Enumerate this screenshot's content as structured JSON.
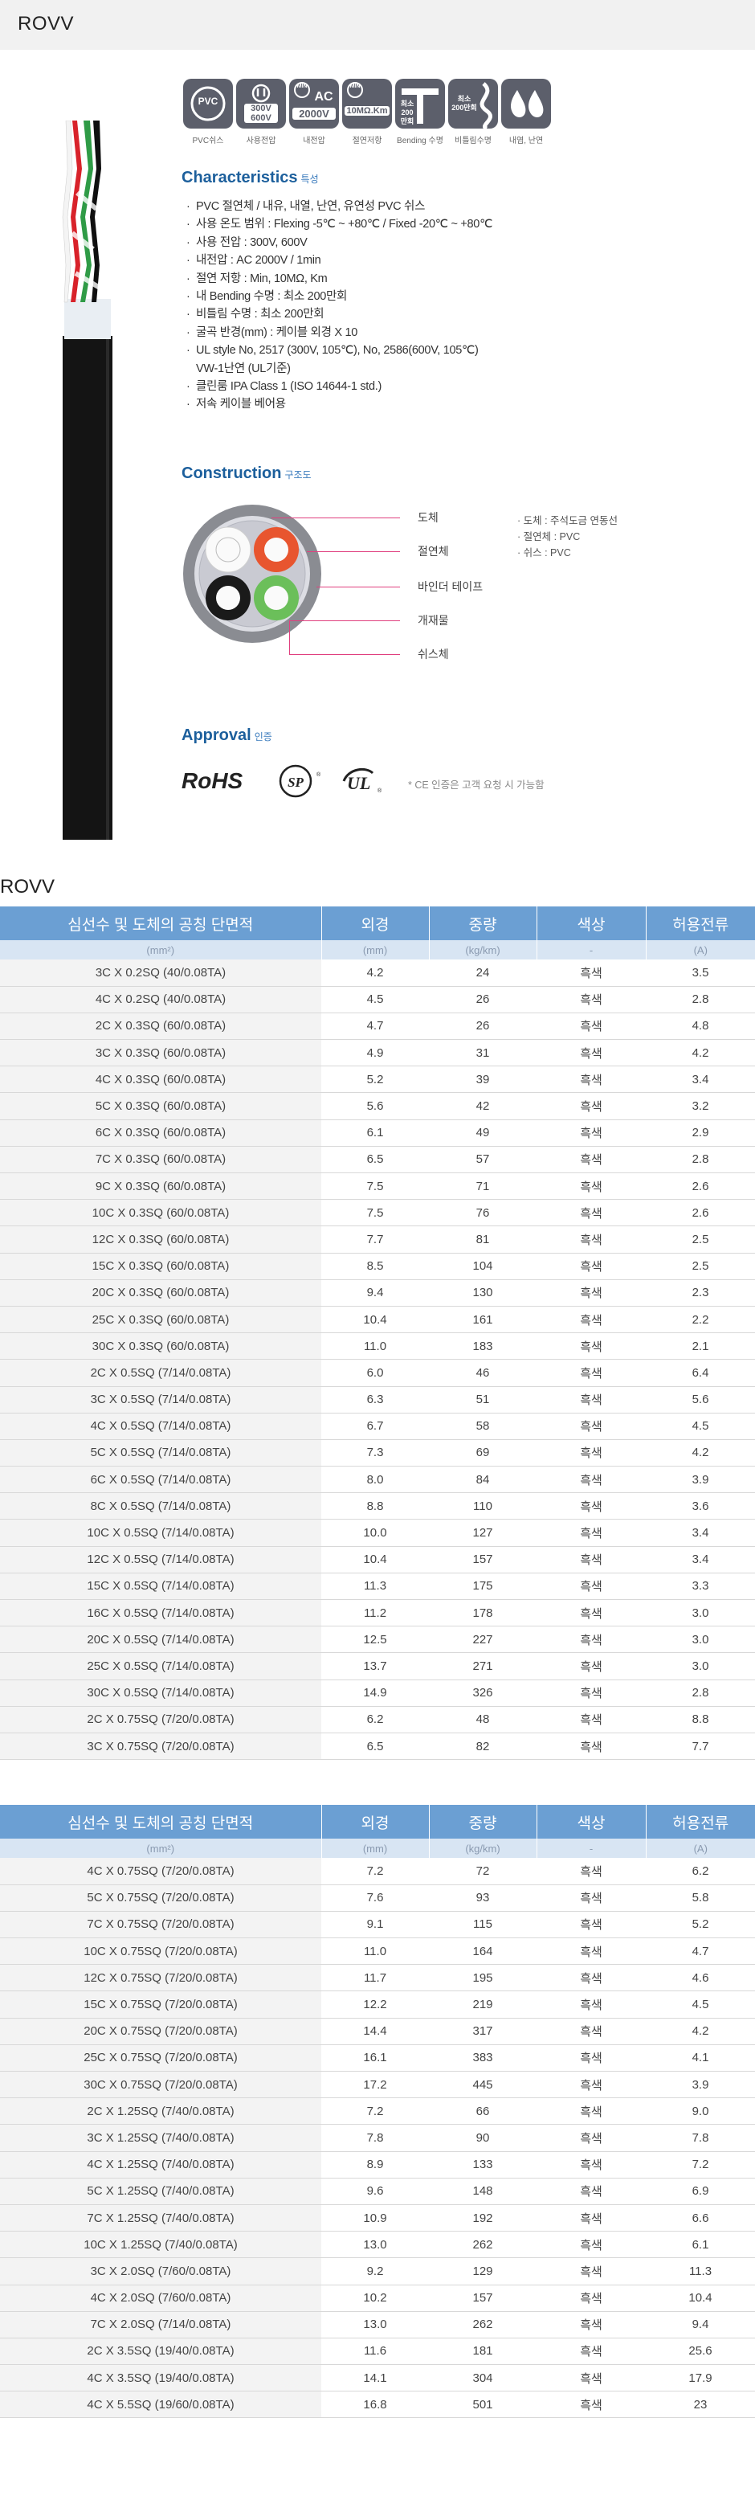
{
  "header": {
    "title": "ROVV"
  },
  "icons": [
    {
      "name": "pvc-sheath-icon",
      "inner": "PVC",
      "caption": "PVC쉬스"
    },
    {
      "name": "voltage-icon",
      "inner": "300V\n600V",
      "caption": "사용전압"
    },
    {
      "name": "withstand-voltage-icon",
      "inner": "AC\n2000V",
      "caption": "내전압"
    },
    {
      "name": "insulation-resistance-icon",
      "inner": "10MΩ.Km",
      "caption": "절연저항"
    },
    {
      "name": "bending-life-icon",
      "inner": "",
      "caption": "Bending 수명"
    },
    {
      "name": "twist-life-icon",
      "inner": "최소\n200만회",
      "caption": "비틀림수명"
    },
    {
      "name": "oil-flame-resistant-icon",
      "inner": "",
      "caption": "내염, 난연"
    }
  ],
  "characteristics": {
    "title": "Characteristics",
    "title_ko": "특성",
    "items": [
      "PVC 절연체 / 내유, 내열, 난연, 유연성 PVC 쉬스",
      "사용 온도 범위 : Flexing -5℃ ~ +80℃ / Fixed -20℃ ~ +80℃",
      "사용 전압 : 300V, 600V",
      "내전압 : AC 2000V / 1min",
      "절연 저항 : Min, 10MΩ, Km",
      "내 Bending 수명 : 최소 200만회",
      "비틀림 수명 : 최소 200만회",
      "굴곡 반경(mm) : 케이블 외경 X 10",
      "UL style No, 2517 (300V, 105℃), No, 2586(600V, 105℃)\nVW-1난연 (UL기준)",
      "클린룸 IPA Class 1 (ISO 14644-1 std.)",
      "저속 케이블 베어용"
    ]
  },
  "construction": {
    "title": "Construction",
    "title_ko": "구조도",
    "labels": [
      "도체",
      "절연체",
      "바인더 테이프",
      "개재물",
      "쉬스체"
    ],
    "legend": [
      "도체 : 주석도금 연동선",
      "절연체 : PVC",
      "쉬스 : PVC"
    ]
  },
  "approval": {
    "title": "Approval",
    "title_ko": "인증",
    "logos": [
      "RoHS",
      "SP",
      "UL"
    ],
    "note": "* CE 인증은 고객 요청 시 가능함"
  },
  "table_caption": "ROVV",
  "table": {
    "headers": [
      "심선수 및 도체의 공칭 단면적",
      "외경",
      "중량",
      "색상",
      "허용전류"
    ],
    "units": [
      "(mm²)",
      "(mm)",
      "(kg/km)",
      "-",
      "(A)"
    ],
    "rows1": [
      [
        "3C X 0.2SQ (40/0.08TA)",
        "4.2",
        "24",
        "흑색",
        "3.5"
      ],
      [
        "4C X 0.2SQ (40/0.08TA)",
        "4.5",
        "26",
        "흑색",
        "2.8"
      ],
      [
        "2C X 0.3SQ (60/0.08TA)",
        "4.7",
        "26",
        "흑색",
        "4.8"
      ],
      [
        "3C X 0.3SQ (60/0.08TA)",
        "4.9",
        "31",
        "흑색",
        "4.2"
      ],
      [
        "4C X 0.3SQ (60/0.08TA)",
        "5.2",
        "39",
        "흑색",
        "3.4"
      ],
      [
        "5C X 0.3SQ (60/0.08TA)",
        "5.6",
        "42",
        "흑색",
        "3.2"
      ],
      [
        "6C X 0.3SQ (60/0.08TA)",
        "6.1",
        "49",
        "흑색",
        "2.9"
      ],
      [
        "7C X 0.3SQ (60/0.08TA)",
        "6.5",
        "57",
        "흑색",
        "2.8"
      ],
      [
        "9C X 0.3SQ (60/0.08TA)",
        "7.5",
        "71",
        "흑색",
        "2.6"
      ],
      [
        "10C X 0.3SQ (60/0.08TA)",
        "7.5",
        "76",
        "흑색",
        "2.6"
      ],
      [
        "12C X 0.3SQ (60/0.08TA)",
        "7.7",
        "81",
        "흑색",
        "2.5"
      ],
      [
        "15C X 0.3SQ (60/0.08TA)",
        "8.5",
        "104",
        "흑색",
        "2.5"
      ],
      [
        "20C X 0.3SQ (60/0.08TA)",
        "9.4",
        "130",
        "흑색",
        "2.3"
      ],
      [
        "25C X 0.3SQ (60/0.08TA)",
        "10.4",
        "161",
        "흑색",
        "2.2"
      ],
      [
        "30C X 0.3SQ (60/0.08TA)",
        "11.0",
        "183",
        "흑색",
        "2.1"
      ],
      [
        "2C X 0.5SQ (7/14/0.08TA)",
        "6.0",
        "46",
        "흑색",
        "6.4"
      ],
      [
        "3C X 0.5SQ (7/14/0.08TA)",
        "6.3",
        "51",
        "흑색",
        "5.6"
      ],
      [
        "4C X 0.5SQ (7/14/0.08TA)",
        "6.7",
        "58",
        "흑색",
        "4.5"
      ],
      [
        "5C X 0.5SQ (7/14/0.08TA)",
        "7.3",
        "69",
        "흑색",
        "4.2"
      ],
      [
        "6C X 0.5SQ (7/14/0.08TA)",
        "8.0",
        "84",
        "흑색",
        "3.9"
      ],
      [
        "8C X 0.5SQ (7/14/0.08TA)",
        "8.8",
        "110",
        "흑색",
        "3.6"
      ],
      [
        "10C X 0.5SQ (7/14/0.08TA)",
        "10.0",
        "127",
        "흑색",
        "3.4"
      ],
      [
        "12C X 0.5SQ (7/14/0.08TA)",
        "10.4",
        "157",
        "흑색",
        "3.4"
      ],
      [
        "15C X 0.5SQ (7/14/0.08TA)",
        "11.3",
        "175",
        "흑색",
        "3.3"
      ],
      [
        "16C X 0.5SQ (7/14/0.08TA)",
        "11.2",
        "178",
        "흑색",
        "3.0"
      ],
      [
        "20C X 0.5SQ (7/14/0.08TA)",
        "12.5",
        "227",
        "흑색",
        "3.0"
      ],
      [
        "25C X 0.5SQ (7/14/0.08TA)",
        "13.7",
        "271",
        "흑색",
        "3.0"
      ],
      [
        "30C X 0.5SQ (7/14/0.08TA)",
        "14.9",
        "326",
        "흑색",
        "2.8"
      ],
      [
        "2C X 0.75SQ (7/20/0.08TA)",
        "6.2",
        "48",
        "흑색",
        "8.8"
      ],
      [
        "3C X 0.75SQ (7/20/0.08TA)",
        "6.5",
        "82",
        "흑색",
        "7.7"
      ]
    ],
    "rows2": [
      [
        "4C X 0.75SQ (7/20/0.08TA)",
        "7.2",
        "72",
        "흑색",
        "6.2"
      ],
      [
        "5C X 0.75SQ (7/20/0.08TA)",
        "7.6",
        "93",
        "흑색",
        "5.8"
      ],
      [
        "7C X 0.75SQ (7/20/0.08TA)",
        "9.1",
        "115",
        "흑색",
        "5.2"
      ],
      [
        "10C X 0.75SQ (7/20/0.08TA)",
        "11.0",
        "164",
        "흑색",
        "4.7"
      ],
      [
        "12C X 0.75SQ (7/20/0.08TA)",
        "11.7",
        "195",
        "흑색",
        "4.6"
      ],
      [
        "15C X 0.75SQ (7/20/0.08TA)",
        "12.2",
        "219",
        "흑색",
        "4.5"
      ],
      [
        "20C X 0.75SQ (7/20/0.08TA)",
        "14.4",
        "317",
        "흑색",
        "4.2"
      ],
      [
        "25C X 0.75SQ (7/20/0.08TA)",
        "16.1",
        "383",
        "흑색",
        "4.1"
      ],
      [
        "30C X 0.75SQ (7/20/0.08TA)",
        "17.2",
        "445",
        "흑색",
        "3.9"
      ],
      [
        "2C X 1.25SQ (7/40/0.08TA)",
        "7.2",
        "66",
        "흑색",
        "9.0"
      ],
      [
        "3C X 1.25SQ (7/40/0.08TA)",
        "7.8",
        "90",
        "흑색",
        "7.8"
      ],
      [
        "4C X 1.25SQ (7/40/0.08TA)",
        "8.9",
        "133",
        "흑색",
        "7.2"
      ],
      [
        "5C X 1.25SQ (7/40/0.08TA)",
        "9.6",
        "148",
        "흑색",
        "6.9"
      ],
      [
        "7C X 1.25SQ (7/40/0.08TA)",
        "10.9",
        "192",
        "흑색",
        "6.6"
      ],
      [
        "10C X 1.25SQ (7/40/0.08TA)",
        "13.0",
        "262",
        "흑색",
        "6.1"
      ],
      [
        "3C X 2.0SQ (7/60/0.08TA)",
        "9.2",
        "129",
        "흑색",
        "11.3"
      ],
      [
        "4C X 2.0SQ (7/60/0.08TA)",
        "10.2",
        "157",
        "흑색",
        "10.4"
      ],
      [
        "7C X 2.0SQ (7/14/0.08TA)",
        "13.0",
        "262",
        "흑색",
        "9.4"
      ],
      [
        "2C X 3.5SQ (19/40/0.08TA)",
        "11.6",
        "181",
        "흑색",
        "25.6"
      ],
      [
        "4C X 3.5SQ (19/40/0.08TA)",
        "14.1",
        "304",
        "흑색",
        "17.9"
      ],
      [
        "4C X 5.5SQ (19/60/0.08TA)",
        "16.8",
        "501",
        "흑색",
        "23"
      ]
    ]
  }
}
